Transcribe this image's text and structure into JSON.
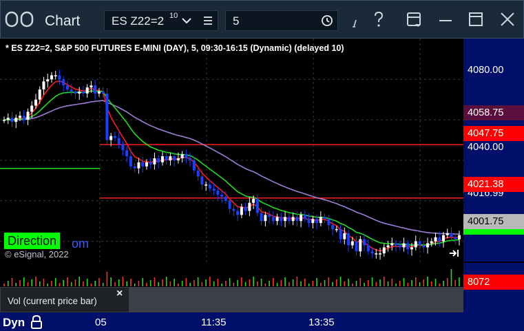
{
  "window": {
    "title": "Chart",
    "symbol": "ES Z22=2",
    "symbol_superscript": "10",
    "interval": "5"
  },
  "chart_header": "* ES Z22=2, S&P 500 FUTURES E-MINI (DAY), 5, 09:30-16:15 (Dynamic) (delayed 10)",
  "overlay": {
    "direction_label": "Direction",
    "direction_link_tail": "om",
    "copyright": "© eSignal, 2022"
  },
  "price_axis": {
    "ticks": [
      "4080.00",
      "4040.00",
      "4016.99"
    ],
    "labels": [
      {
        "text": "4058.75",
        "bg": "#5a0f3c",
        "fg": "#ffffff"
      },
      {
        "text": "4047.75",
        "bg": "#ff0000",
        "fg": "#ffffff"
      },
      {
        "text": "4021.38",
        "bg": "#ff0000",
        "fg": "#ffffff"
      },
      {
        "text": "4001.75",
        "bg": "#b8b8b8",
        "fg": "#000000"
      }
    ]
  },
  "volume": {
    "panel_label": "Vol (current price bar)",
    "current_value": "8072",
    "current_bg": "#ff0000"
  },
  "time_axis": {
    "mode": "Dyn",
    "ticks": [
      "05",
      "11:35",
      "13:35"
    ]
  },
  "colors": {
    "up_candle": "#ffffff",
    "down_candle": "#1a40ff",
    "vwap_line": "#9b7fd8",
    "fast_ma": "#ff1a1a",
    "signal_line": "#22dd22",
    "grid": "#3a3a3a"
  },
  "chart_data": {
    "type": "candlestick",
    "title": "* ES Z22=2, S&P 500 FUTURES E-MINI (DAY), 5, 09:30-16:15 (Dynamic) (delayed 10)",
    "ylim": [
      3990,
      4092
    ],
    "y_ticks": [
      4080.0,
      4040.0
    ],
    "x_tick_labels": [
      "05",
      "11:35",
      "13:35"
    ],
    "closes": [
      4060,
      4061,
      4059,
      4061,
      4062,
      4060,
      4064,
      4067,
      4070,
      4075,
      4079,
      4080,
      4082,
      4082,
      4080,
      4077,
      4075,
      4074,
      4073,
      4074,
      4073,
      4076,
      4077,
      4073,
      4074,
      4073,
      4050,
      4052,
      4051,
      4048,
      4045,
      4042,
      4037,
      4036,
      4039,
      4037,
      4039,
      4038,
      4041,
      4039,
      4042,
      4040,
      4042,
      4040,
      4041,
      4043,
      4041,
      4040,
      4035,
      4032,
      4028,
      4028,
      4026,
      4025,
      4023,
      4022,
      4020,
      4016,
      4015,
      4013,
      4017,
      4015,
      4019,
      4021,
      4014,
      4010,
      4013,
      4012,
      4010,
      4012,
      4010,
      4012,
      4010,
      4012,
      4010,
      4013,
      4011,
      4009,
      4011,
      4009,
      4012,
      4011,
      4008,
      4006,
      4006,
      4001,
      4004,
      3998,
      4000,
      3995,
      4001,
      3998,
      3995,
      3994,
      3994,
      3994,
      3997,
      3998,
      3999,
      3998,
      3997,
      3999,
      3996,
      3997,
      4000,
      3998,
      3997,
      3999,
      4000,
      4002,
      4000,
      4003,
      4004,
      4002,
      4001,
      4003
    ],
    "series": [
      {
        "name": "fast_ma",
        "color": "#ff1a1a"
      },
      {
        "name": "signal_line",
        "color": "#22dd22"
      },
      {
        "name": "vwap_line",
        "color": "#9b7fd8"
      }
    ],
    "horizontal_levels": [
      {
        "value": 4047.75,
        "color": "#ff1a1a"
      },
      {
        "value": 4021.38,
        "color": "#ff1a1a"
      }
    ]
  }
}
